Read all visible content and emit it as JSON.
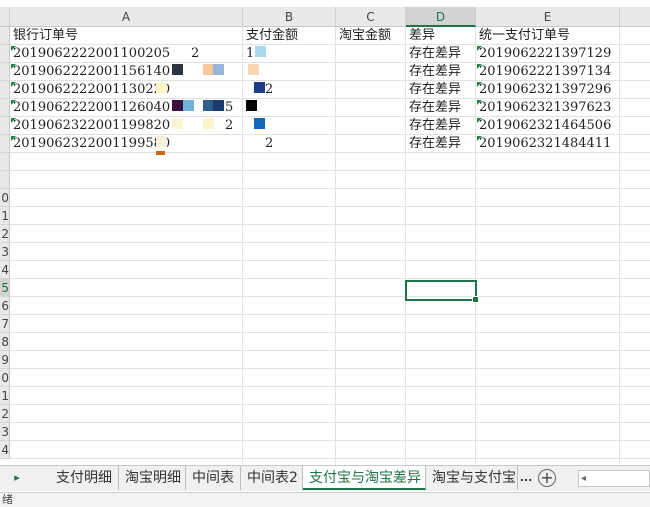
{
  "columns": [
    {
      "letter": "A",
      "selected": false
    },
    {
      "letter": "B",
      "selected": false
    },
    {
      "letter": "C",
      "selected": false
    },
    {
      "letter": "D",
      "selected": true
    },
    {
      "letter": "E",
      "selected": false
    }
  ],
  "headers": {
    "a": "银行订单号",
    "b": "支付金额",
    "c": "淘宝金额",
    "d": "差异",
    "e": "统一支付订单号"
  },
  "rows": [
    {
      "a": "2019062222001100205",
      "a_tail": "2",
      "b": "1",
      "d": "存在差异",
      "e": "2019062221397129"
    },
    {
      "a": "2019062222001156140",
      "a_tail": "",
      "b": "",
      "d": "存在差异",
      "e": "2019062221397134"
    },
    {
      "a": "2019062222001130220",
      "a_tail": "",
      "b": "2",
      "d": "存在差异",
      "e": "2019062321397296"
    },
    {
      "a": "2019062222001126040",
      "a_tail": "5",
      "b": "",
      "d": "存在差异",
      "e": "2019062321397623"
    },
    {
      "a": "2019062322001199820",
      "a_tail": "2",
      "b": "",
      "d": "存在差异",
      "e": "2019062321464506"
    },
    {
      "a": "2019062322001199580",
      "a_tail": "",
      "b": "2",
      "d": "存在差异",
      "e": "2019062321484411"
    }
  ],
  "row_numbers": [
    "",
    "",
    "",
    "",
    "",
    "",
    "",
    "",
    "",
    "0",
    "1",
    "2",
    "3",
    "4",
    "5",
    "6",
    "7",
    "8",
    "9",
    "0",
    "1",
    "2",
    "3",
    "4"
  ],
  "selected_row_label": "5",
  "sheet_tabs": [
    {
      "label": "支付明细",
      "active": false
    },
    {
      "label": "淘宝明细",
      "active": false
    },
    {
      "label": "中间表",
      "active": false
    },
    {
      "label": "中间表2",
      "active": false
    },
    {
      "label": "支付宝与淘宝差异",
      "active": true
    },
    {
      "label": "淘宝与支付宝",
      "active": false
    }
  ],
  "tab_more": "...",
  "tab_nav_next": "▸",
  "add_sheet": "+",
  "hscroll_left": "◂",
  "status_text": "绪",
  "colors": {
    "accent": "#217346",
    "grid": "#e2e2e2",
    "header_bg": "#e9e9e9",
    "error_triangle": "#1e8449"
  }
}
